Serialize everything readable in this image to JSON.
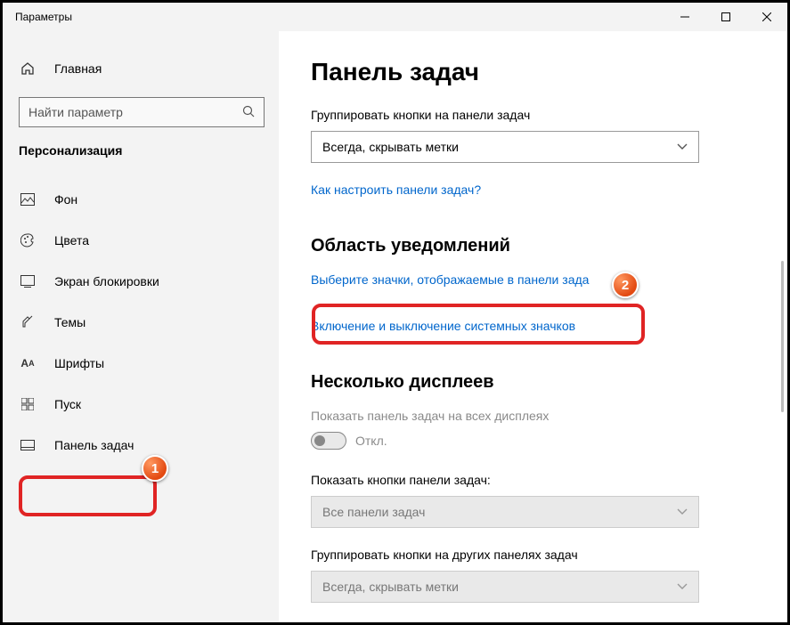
{
  "window": {
    "title": "Параметры"
  },
  "sidebar": {
    "home": "Главная",
    "search_placeholder": "Найти параметр",
    "category": "Персонализация",
    "items": [
      {
        "label": "Фон",
        "icon": "image-icon"
      },
      {
        "label": "Цвета",
        "icon": "palette-icon"
      },
      {
        "label": "Экран блокировки",
        "icon": "lock-screen-icon"
      },
      {
        "label": "Темы",
        "icon": "themes-icon"
      },
      {
        "label": "Шрифты",
        "icon": "fonts-icon"
      },
      {
        "label": "Пуск",
        "icon": "start-icon"
      },
      {
        "label": "Панель задач",
        "icon": "taskbar-icon"
      }
    ]
  },
  "main": {
    "title": "Панель задач",
    "group_label": "Группировать кнопки на панели задач",
    "group_value": "Всегда, скрывать метки",
    "help_link": "Как настроить панели задач?",
    "notif_section": "Область уведомлений",
    "notif_link1": "Выберите значки, отображаемые в панели зада",
    "notif_link2": "Включение и выключение системных значков",
    "multi_section": "Несколько дисплеев",
    "multi_toggle_label": "Показать панель задач на всех дисплеях",
    "multi_toggle_state": "Откл.",
    "show_buttons_label": "Показать кнопки панели задач:",
    "show_buttons_value": "Все панели задач",
    "group_other_label": "Группировать кнопки на других панелях задач",
    "group_other_value": "Всегда, скрывать метки"
  },
  "annotations": {
    "badge1": "1",
    "badge2": "2"
  }
}
